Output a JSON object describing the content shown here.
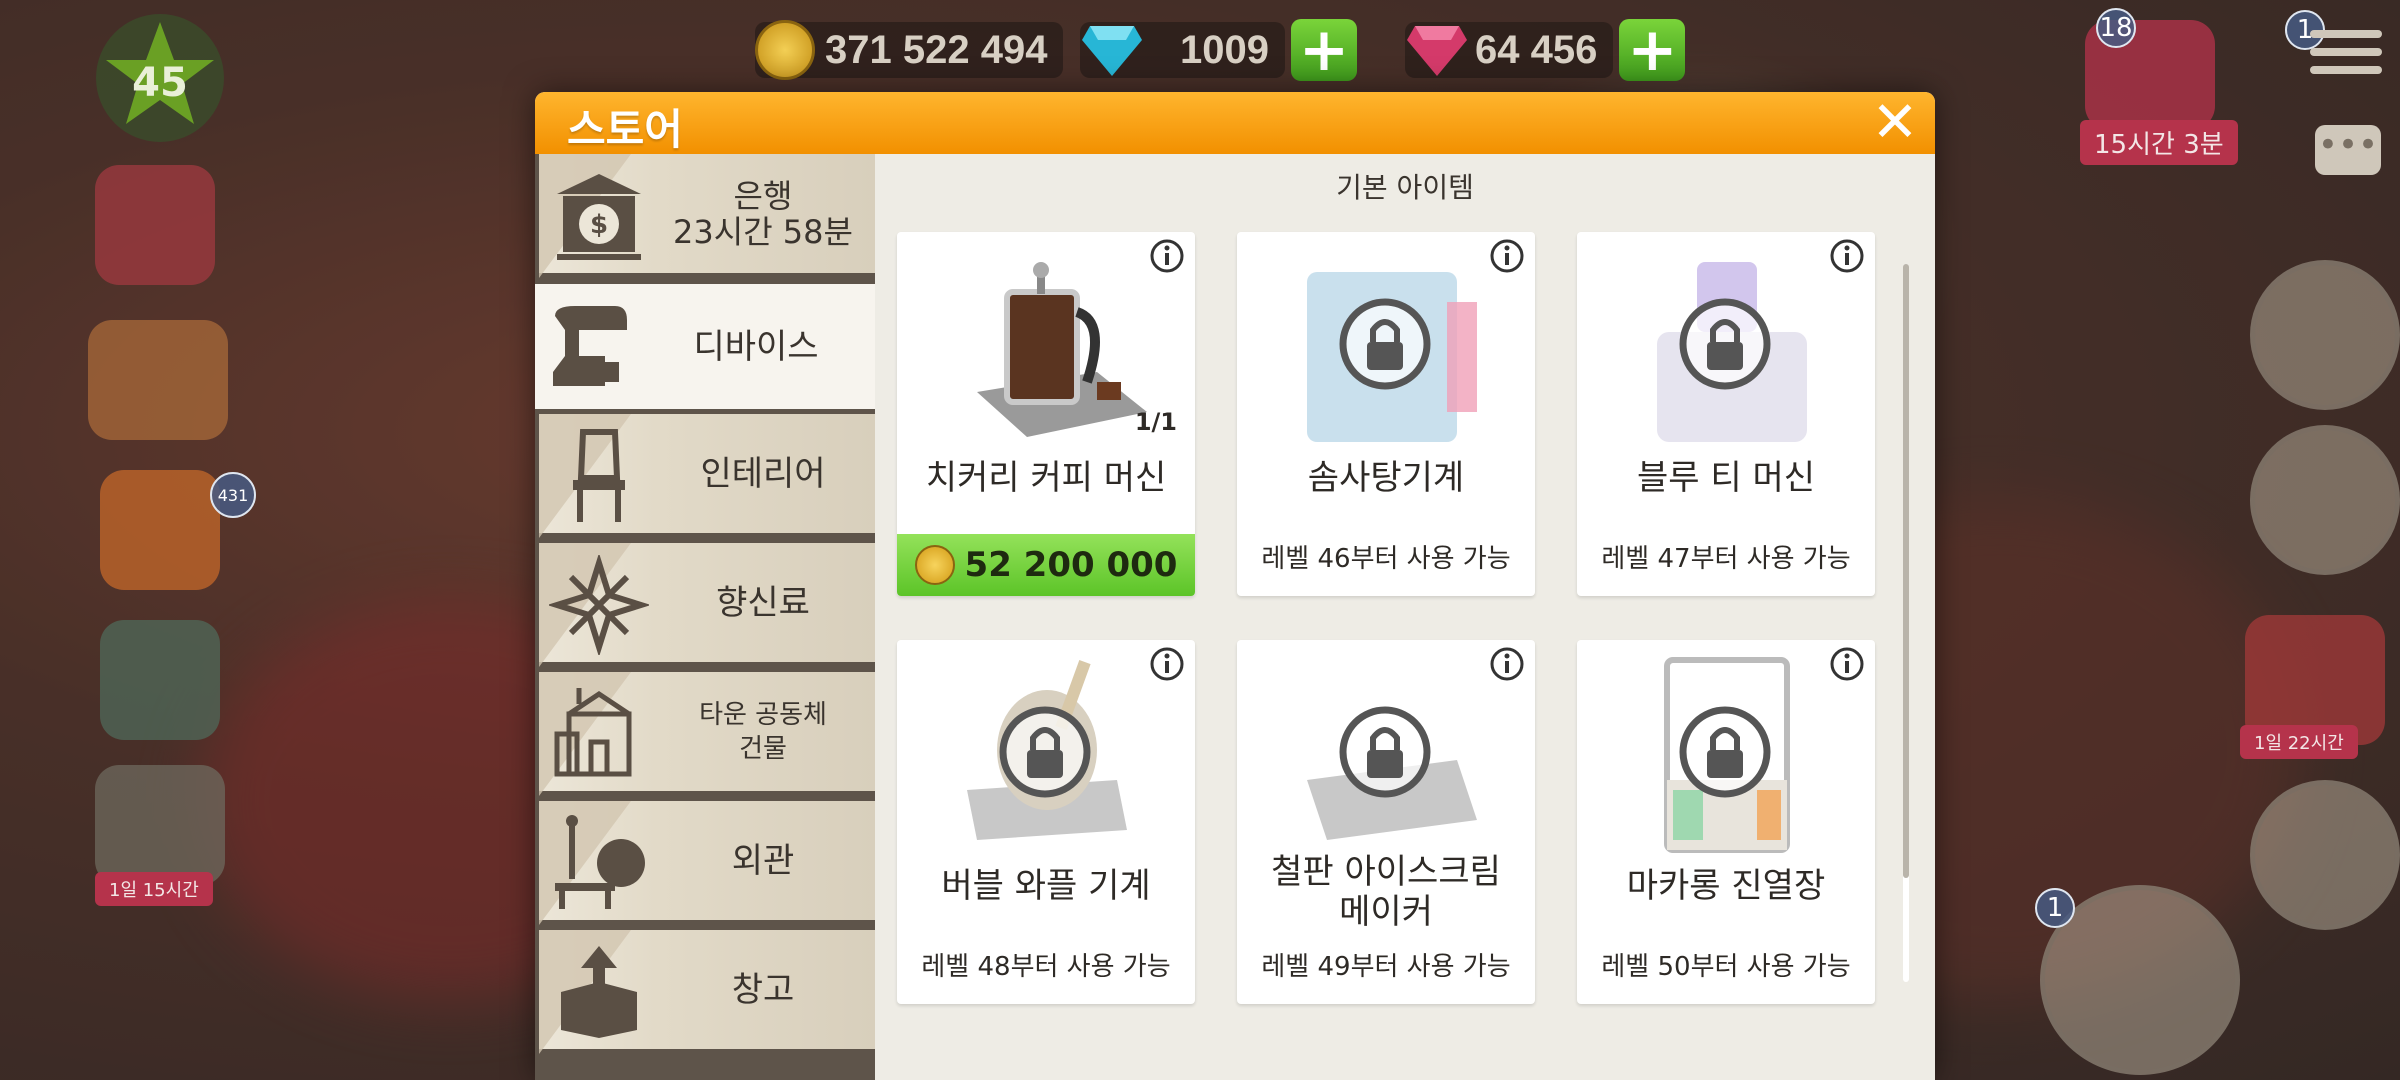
{
  "currencies": {
    "coins": "371 522 494",
    "diamonds": "1009",
    "rubies": "64 456"
  },
  "hud": {
    "level": "45",
    "event_timer_left": "1일 15시간",
    "gift_count": "431",
    "right_gift_count": "18",
    "right_gift_timer": "15시간 3분",
    "menu_badge": "1",
    "balloon_timer": "1일 22시간",
    "register_badge": "1"
  },
  "store": {
    "title": "스토어",
    "close": "✕",
    "categories": [
      {
        "label": "은행\n23시간 58분"
      },
      {
        "label": "디바이스"
      },
      {
        "label": "인테리어"
      },
      {
        "label": "향신료"
      },
      {
        "label": "타운 공동체\n건물"
      },
      {
        "label": "외관"
      },
      {
        "label": "창고"
      }
    ],
    "section_title": "기본 아이템",
    "items": [
      {
        "name": "치커리 커피 머신",
        "count": "1/1",
        "price": "52 200 000"
      },
      {
        "name": "솜사탕기계",
        "requirement": "레벨 46부터 사용 가능"
      },
      {
        "name": "블루 티 머신",
        "requirement": "레벨 47부터 사용 가능"
      },
      {
        "name": "버블 와플 기계",
        "requirement": "레벨 48부터 사용 가능"
      },
      {
        "name": "철판 아이스크림\n메이커",
        "requirement": "레벨 49부터 사용 가능"
      },
      {
        "name": "마카롱 진열장",
        "requirement": "레벨 50부터 사용 가능"
      }
    ]
  },
  "colors": {
    "header_orange": "#f29000",
    "price_green": "#5cc428",
    "sidebar_dark": "#5e544a"
  },
  "icons": {
    "bank": "bank-icon",
    "devices": "mixer-icon",
    "interior": "chair-icon",
    "spices": "star-anise-icon",
    "town": "town-building-icon",
    "exterior": "bench-tree-icon",
    "storage": "box-icon"
  }
}
